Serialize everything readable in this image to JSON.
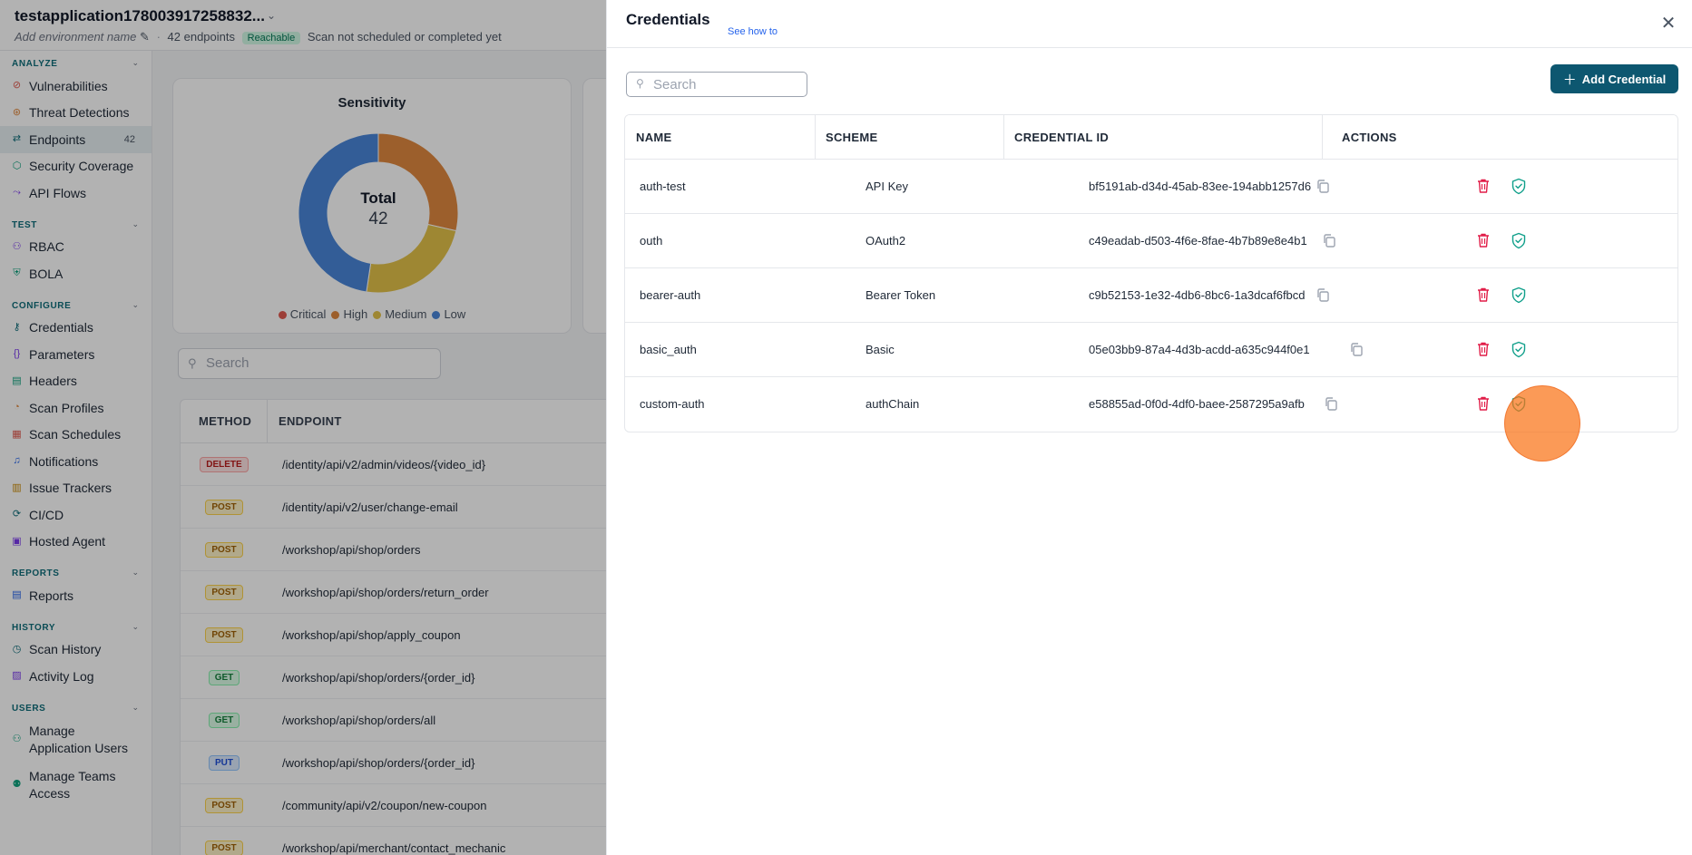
{
  "app": {
    "title": "testapplication17800391725883​2...",
    "env_placeholder": "Add environment name",
    "endpoints_text": "42 endpoints",
    "reachable_badge": "Reachable",
    "scan_status": "Scan not scheduled or completed yet"
  },
  "sidebar": {
    "sections": [
      {
        "label": "ANALYZE",
        "items": [
          {
            "label": "Vulnerabilities",
            "icon": "vulnerability-icon"
          },
          {
            "label": "Threat Detections",
            "icon": "threat-icon"
          },
          {
            "label": "Endpoints",
            "icon": "endpoints-icon",
            "count": "42",
            "active": true
          },
          {
            "label": "Security Coverage",
            "icon": "coverage-icon"
          },
          {
            "label": "API Flows",
            "icon": "flows-icon"
          }
        ]
      },
      {
        "label": "TEST",
        "items": [
          {
            "label": "RBAC",
            "icon": "rbac-icon"
          },
          {
            "label": "BOLA",
            "icon": "bola-icon"
          }
        ]
      },
      {
        "label": "CONFIGURE",
        "items": [
          {
            "label": "Credentials",
            "icon": "key-icon"
          },
          {
            "label": "Parameters",
            "icon": "braces-icon"
          },
          {
            "label": "Headers",
            "icon": "headers-icon"
          },
          {
            "label": "Scan Profiles",
            "icon": "profile-icon"
          },
          {
            "label": "Scan Schedules",
            "icon": "calendar-icon"
          },
          {
            "label": "Notifications",
            "icon": "bell-icon"
          },
          {
            "label": "Issue Trackers",
            "icon": "tracker-icon"
          },
          {
            "label": "CI/CD",
            "icon": "cicd-icon"
          },
          {
            "label": "Hosted Agent",
            "icon": "agent-icon"
          }
        ]
      },
      {
        "label": "REPORTS",
        "items": [
          {
            "label": "Reports",
            "icon": "report-icon"
          }
        ]
      },
      {
        "label": "HISTORY",
        "items": [
          {
            "label": "Scan History",
            "icon": "history-icon"
          },
          {
            "label": "Activity Log",
            "icon": "log-icon"
          }
        ]
      },
      {
        "label": "USERS",
        "items": [
          {
            "label": "Manage Application Users",
            "icon": "users-icon",
            "two_line": true
          },
          {
            "label": "Manage Teams Access",
            "icon": "team-icon",
            "two_line": true
          }
        ]
      }
    ]
  },
  "sensitivity": {
    "title": "Sensitivity",
    "total_label": "Total",
    "total_value": "42",
    "legend": [
      {
        "label": "Critical",
        "color": "#e05a4f"
      },
      {
        "label": "High",
        "color": "#e0893f"
      },
      {
        "label": "Medium",
        "color": "#e3c24a"
      },
      {
        "label": "Low",
        "color": "#4a86d8"
      }
    ],
    "chart_data": {
      "type": "pie",
      "categories": [
        "Critical",
        "High",
        "Medium",
        "Low"
      ],
      "values": [
        0,
        12,
        10,
        20
      ]
    }
  },
  "endpoints": {
    "search_placeholder": "Search",
    "headers": {
      "method": "METHOD",
      "endpoint": "ENDPOINT"
    },
    "rows": [
      {
        "method": "DELETE",
        "kind": "delete",
        "path": "/identity/api/v2/admin/videos/{video_id}"
      },
      {
        "method": "POST",
        "kind": "post",
        "path": "/identity/api/v2/user/change-email"
      },
      {
        "method": "POST",
        "kind": "post",
        "path": "/workshop/api/shop/orders"
      },
      {
        "method": "POST",
        "kind": "post",
        "path": "/workshop/api/shop/orders/return_order"
      },
      {
        "method": "POST",
        "kind": "post",
        "path": "/workshop/api/shop/apply_coupon"
      },
      {
        "method": "GET",
        "kind": "get",
        "path": "/workshop/api/shop/orders/{order_id}"
      },
      {
        "method": "GET",
        "kind": "get",
        "path": "/workshop/api/shop/orders/all"
      },
      {
        "method": "PUT",
        "kind": "put",
        "path": "/workshop/api/shop/orders/{order_id}"
      },
      {
        "method": "POST",
        "kind": "post",
        "path": "/community/api/v2/coupon/new-coupon"
      },
      {
        "method": "POST",
        "kind": "post",
        "path": "/workshop/api/merchant/contact_mechanic"
      }
    ]
  },
  "drawer": {
    "title": "Credentials",
    "see_how": "See how to",
    "search_placeholder": "Search",
    "add_button": "Add Credential",
    "headers": {
      "name": "NAME",
      "scheme": "SCHEME",
      "id": "CREDENTIAL ID",
      "actions": "ACTIONS"
    },
    "rows": [
      {
        "name": "auth-test",
        "scheme": "API Key",
        "id": "bf5191ab-d34d-45ab-83ee-194abb1257d6"
      },
      {
        "name": "outh",
        "scheme": "OAuth2",
        "id": "c49eadab-d503-4f6e-8fae-4b7b89e8e4b1"
      },
      {
        "name": "bearer-auth",
        "scheme": "Bearer Token",
        "id": "c9b52153-1e32-4db6-8bc6-1a3dcaf6fbcd"
      },
      {
        "name": "basic_auth",
        "scheme": "Basic",
        "id": "05e03bb9-87a4-4d3b-acdd-a635c944f0e1"
      },
      {
        "name": "custom-auth",
        "scheme": "authChain",
        "id": "e58855ad-0f0d-4df0-baee-2587295a9afb"
      }
    ]
  },
  "colors": {
    "accent": "#0d5770",
    "delete_icon": "#e11d48",
    "verify_icon": "#0f9f8a",
    "click_marker": "#f97316"
  }
}
